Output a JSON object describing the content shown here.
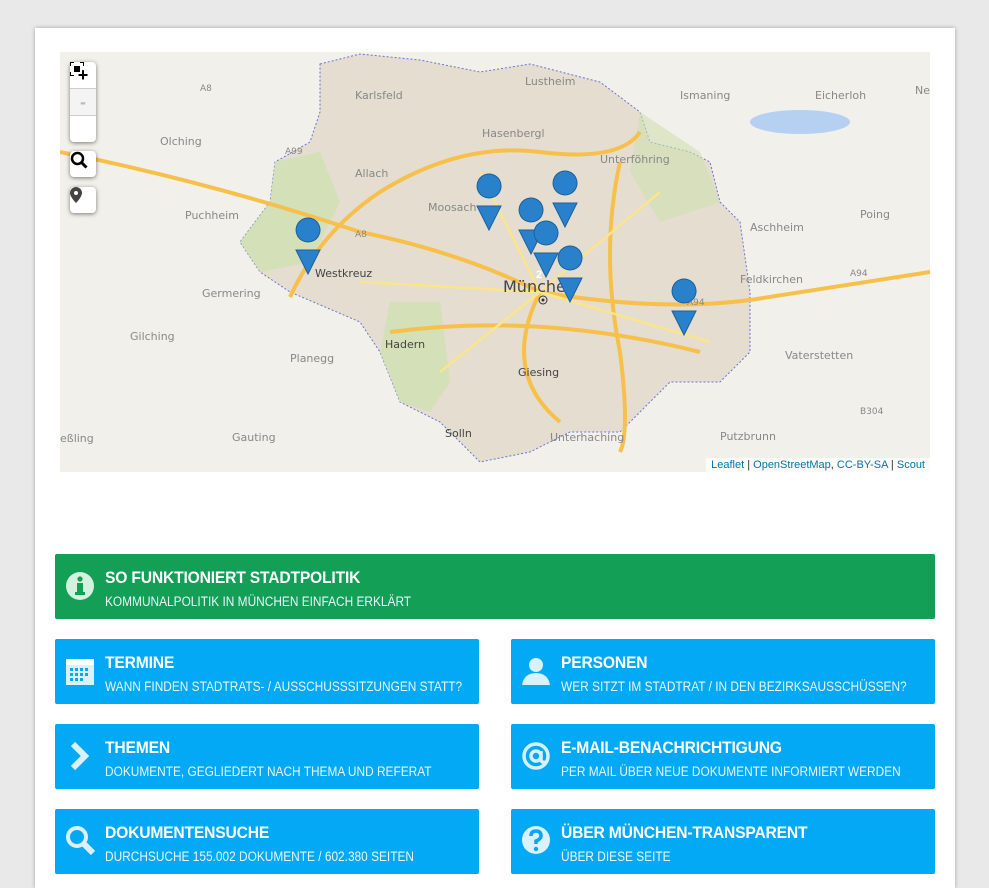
{
  "map": {
    "controls": {
      "zoom_in": "+",
      "zoom_out": "-"
    },
    "labels": [
      "Lustheim",
      "Eicherloh",
      "Karlsfeld",
      "Ismaning",
      "Neu",
      "A8",
      "Olching",
      "Hasenbergl",
      "A99",
      "Unterföhring",
      "Allach",
      "Moosach",
      "Puchheim",
      "Poing",
      "Aschheim",
      "A8",
      "Westkreuz",
      "München",
      "Feldkirchen",
      "A94",
      "Germering",
      "A94",
      "Gilching",
      "Planegg",
      "Hadern",
      "Vaterstetten",
      "Giesing",
      "B304",
      "Gauting",
      "Solln",
      "Unterhaching",
      "Putzbrunn",
      "eßling"
    ],
    "cluster_count": "2",
    "attribution": {
      "leaflet": "Leaflet",
      "osm": "OpenStreetMap",
      "license": "CC-BY-SA",
      "scout": "Scout"
    }
  },
  "featured": {
    "title": "SO FUNKTIONIERT STADTPOLITIK",
    "subtitle": "KOMMUNALPOLITIK IN MÜNCHEN EINFACH ERKLÄRT",
    "color": "#139f56",
    "icon": "info-icon"
  },
  "tiles": [
    {
      "title": "TERMINE",
      "subtitle": "WANN FINDEN STADTRATS- / AUSSCHUSSSITZUNGEN STATT?",
      "icon": "calendar-icon"
    },
    {
      "title": "PERSONEN",
      "subtitle": "WER SITZT IM STADTRAT / IN DEN BEZIRKSAUSSCHÜSSEN?",
      "icon": "person-icon"
    },
    {
      "title": "THEMEN",
      "subtitle": "DOKUMENTE, GEGLIEDERT NACH THEMA UND REFERAT",
      "icon": "chevron-right-icon"
    },
    {
      "title": "E-MAIL-BENACHRICHTIGUNG",
      "subtitle": "PER MAIL ÜBER NEUE DOKUMENTE INFORMIERT WERDEN",
      "icon": "at-icon"
    },
    {
      "title": "DOKUMENTENSUCHE",
      "subtitle": "DURCHSUCHE 155.002 DOKUMENTE / 602.380 SEITEN",
      "icon": "search-icon"
    },
    {
      "title": "ÜBER MÜNCHEN-TRANSPARENT",
      "subtitle": "ÜBER DIESE SEITE",
      "icon": "question-icon"
    }
  ],
  "colors": {
    "tile": "#03a9f4",
    "marker": "#2a81cb"
  }
}
